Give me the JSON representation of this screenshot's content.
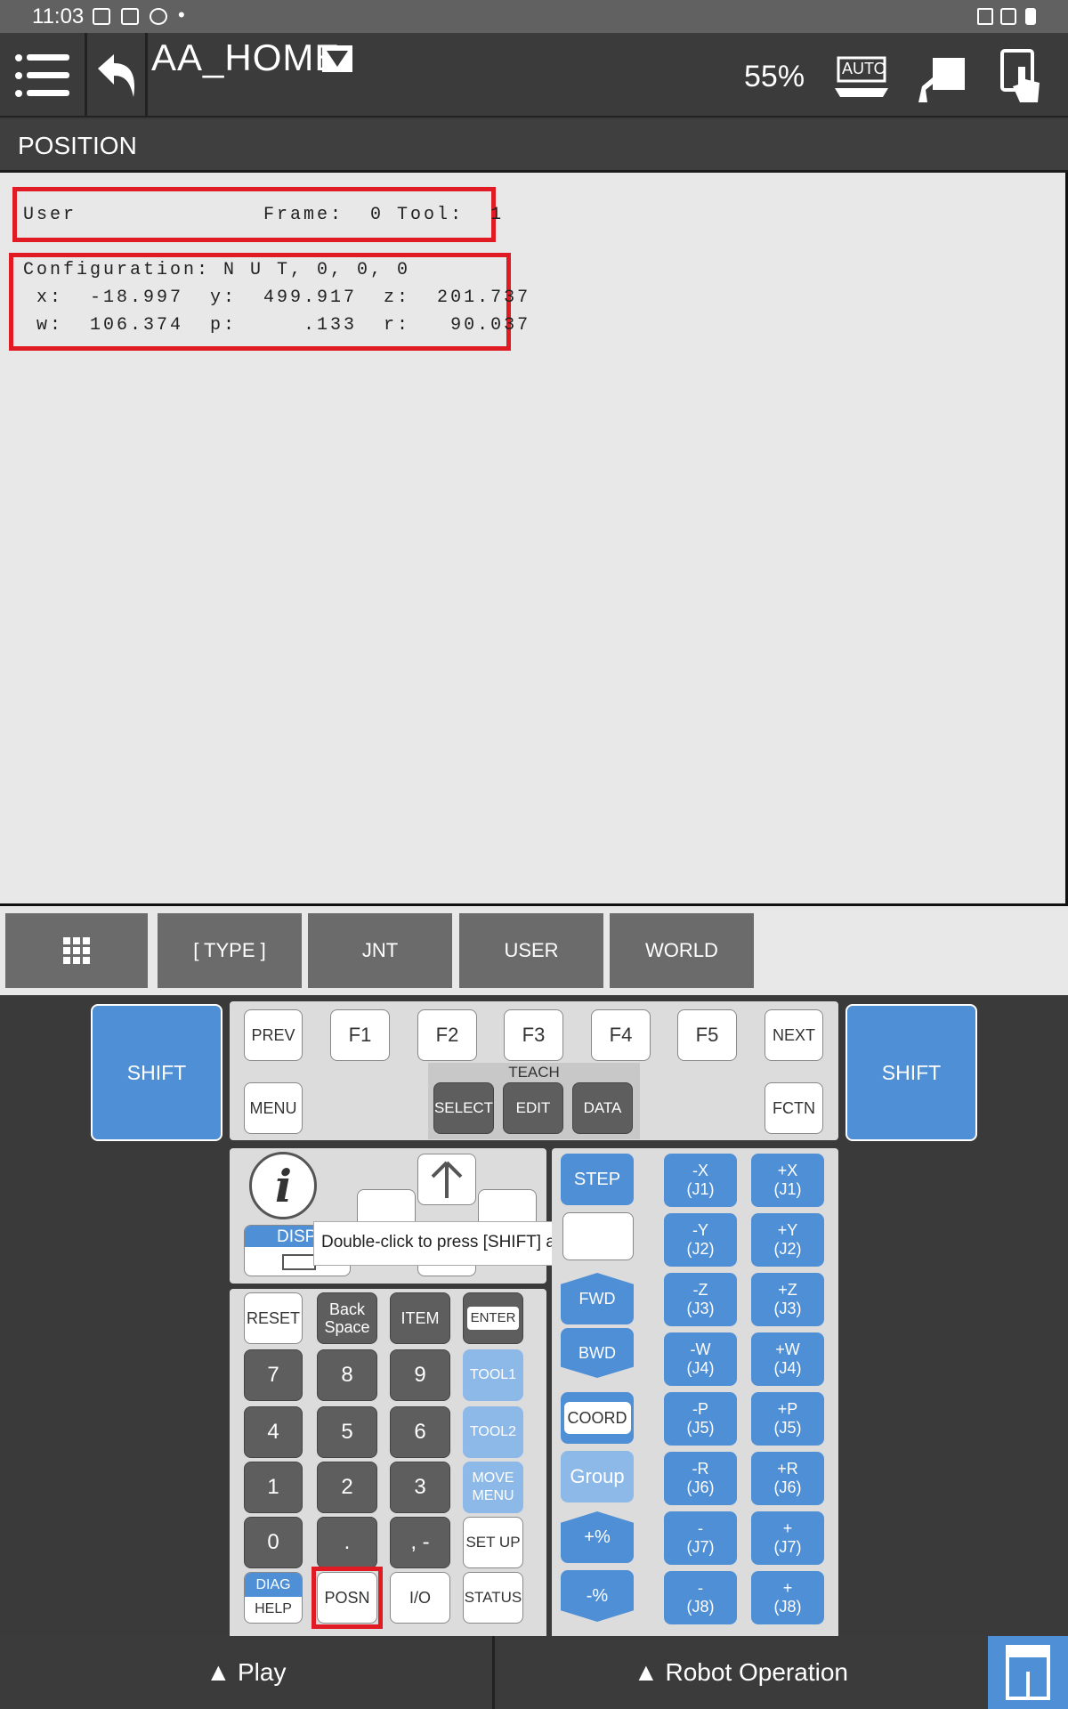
{
  "status_bar": {
    "time": "11:03",
    "dot": "•"
  },
  "header": {
    "menu_icon": "hamburger-menu-icon",
    "back_icon": "undo-arrow-icon",
    "program_name": "AA_HOME",
    "override": "55%",
    "auto_label": "AUTO",
    "icons": [
      "auto-mode-icon",
      "robot-display-icon",
      "touch-panel-icon"
    ]
  },
  "title": "POSITION",
  "position": {
    "frame_line": "User              Frame:  0 Tool:  1",
    "config_line": "Configuration: N U T, 0, 0, 0",
    "xyz_line": " x:  -18.997  y:  499.917  z:  201.737",
    "wpr_line": " w:  106.374  p:     .133  r:   90.037"
  },
  "function_keys": {
    "f1": "[ TYPE ]",
    "f2": "JNT",
    "f3": "USER",
    "f4": "WORLD"
  },
  "keypad": {
    "shift": "SHIFT",
    "prev": "PREV",
    "f1": "F1",
    "f2": "F2",
    "f3": "F3",
    "f4": "F4",
    "f5": "F5",
    "next": "NEXT",
    "menu": "MENU",
    "teach": "TEACH",
    "select": "SELECT",
    "edit": "EDIT",
    "data": "DATA",
    "fctn": "FCTN",
    "disp": "DISP",
    "tooltip": "Double-click to press [SHIFT] at a time.",
    "reset": "RESET",
    "backspace": "Back Space",
    "item": "ITEM",
    "enter": "ENTER",
    "n7": "7",
    "n8": "8",
    "n9": "9",
    "tool1": "TOOL1",
    "n4": "4",
    "n5": "5",
    "n6": "6",
    "tool2": "TOOL2",
    "n1": "1",
    "n2": "2",
    "n3": "3",
    "move_menu": "MOVE MENU",
    "n0": "0",
    "dot": ".",
    "comma": ", -",
    "setup": "SET UP",
    "diag": "DIAG",
    "help": "HELP",
    "posn": "POSN",
    "io": "I/O",
    "status": "STATUS",
    "step": "STEP",
    "fwd": "FWD",
    "bwd": "BWD",
    "coord": "COORD",
    "group": "Group",
    "plus_pct": "+%",
    "minus_pct": "-%",
    "jog": [
      [
        "-X",
        "(J1)",
        "+X",
        "(J1)"
      ],
      [
        "-Y",
        "(J2)",
        "+Y",
        "(J2)"
      ],
      [
        "-Z",
        "(J3)",
        "+Z",
        "(J3)"
      ],
      [
        "-W",
        "(J4)",
        "+W",
        "(J4)"
      ],
      [
        "-P",
        "(J5)",
        "+P",
        "(J5)"
      ],
      [
        "-R",
        "(J6)",
        "+R",
        "(J6)"
      ],
      [
        "-",
        "(J7)",
        "+",
        "(J7)"
      ],
      [
        "-",
        "(J8)",
        "+",
        "(J8)"
      ]
    ]
  },
  "bottom": {
    "play": "▲  Play",
    "robot_op": "▲  Robot Operation"
  }
}
